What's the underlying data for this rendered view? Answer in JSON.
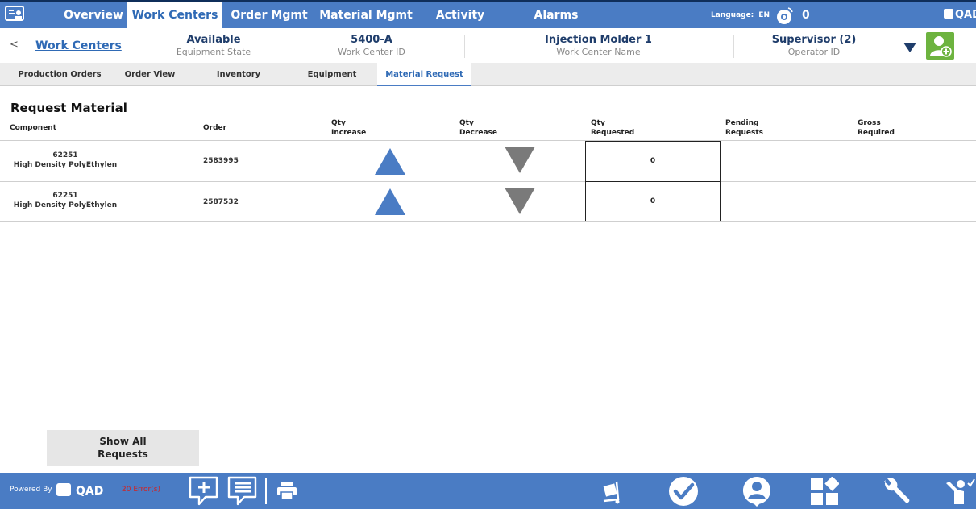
{
  "topnav": {
    "tabs": [
      {
        "label": "Overview",
        "active": false
      },
      {
        "label": "Work Centers",
        "active": true
      },
      {
        "label": "Order Mgmt",
        "active": false
      },
      {
        "label": "Material Mgmt",
        "active": false
      },
      {
        "label": "Activity Mgmt",
        "active": false
      },
      {
        "label": "Alarms",
        "active": false
      }
    ],
    "language_label": "Language:",
    "language_value": "EN",
    "alarm_count": "0",
    "brand": "QAD"
  },
  "infobar": {
    "back": "<",
    "breadcrumb": "Work Centers",
    "equipment_state": {
      "value": "Available",
      "label": "Equipment State"
    },
    "work_center_id": {
      "value": "5400-A",
      "label": "Work Center ID"
    },
    "work_center_name": {
      "value": "Injection Molder 1",
      "label": "Work Center Name"
    },
    "operator": {
      "value": "Supervisor (2)",
      "label": "Operator ID"
    }
  },
  "subtabs": [
    {
      "label": "Production Orders",
      "active": false
    },
    {
      "label": "Order View",
      "active": false
    },
    {
      "label": "Inventory",
      "active": false
    },
    {
      "label": "Equipment",
      "active": false
    },
    {
      "label": "Material Request",
      "active": true
    }
  ],
  "section_title": "Request Material",
  "table": {
    "columns": {
      "component": "Component",
      "order": "Order",
      "qty_increase": [
        "Qty",
        "Increase"
      ],
      "qty_decrease": [
        "Qty",
        "Decrease"
      ],
      "qty_requested": [
        "Qty",
        "Requested"
      ],
      "pending_requests": [
        "Pending",
        "Requests"
      ],
      "gross_required": [
        "Gross",
        "Required"
      ]
    },
    "rows": [
      {
        "component_id": "62251",
        "component_desc": "High Density PolyEthylen",
        "order": "2583995",
        "qty_requested": "0"
      },
      {
        "component_id": "62251",
        "component_desc": "High Density PolyEthylen",
        "order": "2587532",
        "qty_requested": "0"
      }
    ]
  },
  "show_all_button": {
    "line1": "Show All",
    "line2": "Requests"
  },
  "footer": {
    "powered_by": "Powered By",
    "brand": "QAD",
    "errors": "20 Error(s)",
    "icons": [
      "add-message-icon",
      "messages-icon",
      "print-icon",
      "material-cart-icon",
      "complete-icon",
      "operator-icon",
      "dashboard-icon",
      "maintenance-icon",
      "labor-report-icon"
    ],
    "colors": {
      "bar": "#4a7cc4",
      "errors": "#d4201f",
      "add_operator": "#6db33f"
    }
  }
}
